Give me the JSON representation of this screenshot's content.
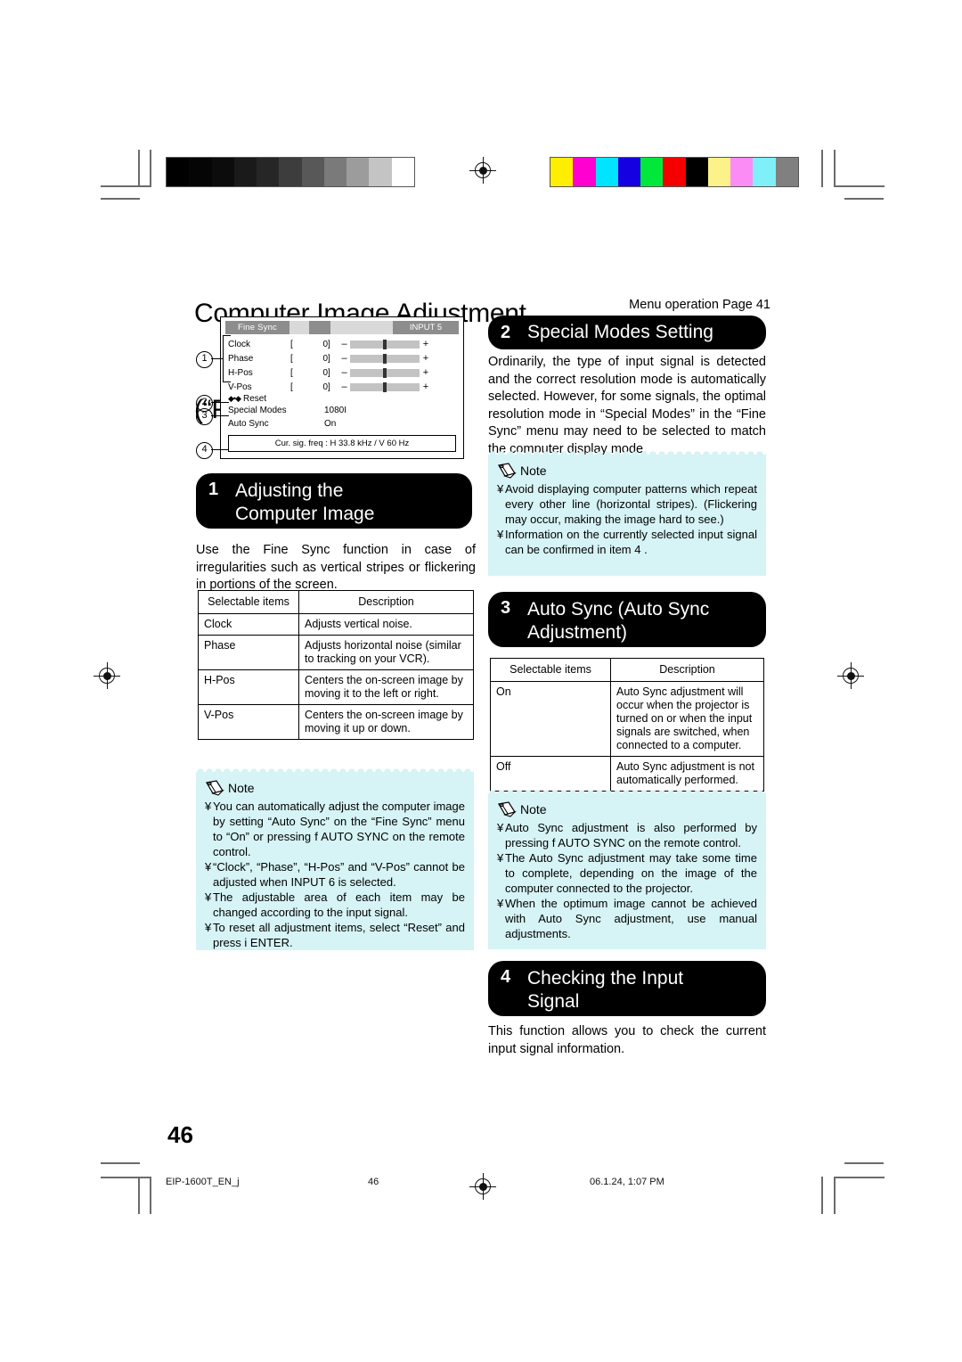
{
  "document": {
    "title_line1": "Computer Image Adjustment",
    "title_line2": "(“Fine Sync” menu)",
    "menu_operation_ref": "Menu operation      Page 41",
    "page_number": "46"
  },
  "footer": {
    "file_name": "EIP-1600T_EN_j",
    "page": "46",
    "timestamp": "06.1.24, 1:07 PM"
  },
  "osd": {
    "tab_label": "Fine Sync",
    "input_label": "INPUT 5",
    "rows": [
      {
        "label": "Clock",
        "bracket_left": "[",
        "value": "0",
        "bracket_right": "]",
        "minus": "–",
        "plus": "+"
      },
      {
        "label": "Phase",
        "bracket_left": "[",
        "value": "0",
        "bracket_right": "]",
        "minus": "–",
        "plus": "+"
      },
      {
        "label": "H-Pos",
        "bracket_left": "[",
        "value": "0",
        "bracket_right": "]",
        "minus": "–",
        "plus": "+"
      },
      {
        "label": "V-Pos",
        "bracket_left": "[",
        "value": "0",
        "bracket_right": "]",
        "minus": "–",
        "plus": "+"
      }
    ],
    "reset_label": "Reset",
    "reset_icons": "◆•◆",
    "special_modes": {
      "key": "Special Modes",
      "value": "1080I"
    },
    "auto_sync": {
      "key": "Auto Sync",
      "value": "On"
    },
    "status_bar": "Cur. sig. freq : H 33.8 kHz / V 60 Hz",
    "callouts": [
      "1",
      "2",
      "3",
      "4"
    ]
  },
  "sections": {
    "one": {
      "number": "1",
      "title": "Adjusting the\nComputer Image",
      "body": "Use the Fine Sync function in case of irregularities such as vertical stripes or flickering in portions of the screen."
    },
    "two": {
      "number": "2",
      "title": "Special Modes Setting",
      "body": "Ordinarily, the type of input signal is detected and the correct resolution mode is automatically selected. However, for some signals, the optimal resolution mode in “Special Modes” in the “Fine Sync” menu may need to be selected to match the computer display mode."
    },
    "three": {
      "number": "3",
      "title": "Auto Sync (Auto Sync\nAdjustment)"
    },
    "four": {
      "number": "4",
      "title": "Checking the Input\nSignal",
      "body": "This function allows you to check the current input signal information."
    }
  },
  "table_fine_sync": {
    "headers": [
      "Selectable items",
      "Description"
    ],
    "rows": [
      [
        "Clock",
        "Adjusts vertical noise."
      ],
      [
        "Phase",
        "Adjusts horizontal noise (similar to tracking on your VCR)."
      ],
      [
        "H-Pos",
        "Centers the on-screen image by moving it to the left or right."
      ],
      [
        "V-Pos",
        "Centers the on-screen image by moving it up or down."
      ]
    ]
  },
  "table_auto_sync": {
    "headers": [
      "Selectable items",
      "Description"
    ],
    "rows": [
      [
        "On",
        "Auto Sync adjustment will occur when the projector is turned on or when the input signals are switched, when connected to a computer."
      ],
      [
        "Off",
        "Auto Sync adjustment is not automatically performed."
      ]
    ]
  },
  "notes": {
    "label": "Note",
    "bullet": "¥",
    "left_fine_sync": [
      "You can automatically adjust the computer image by setting “Auto Sync” on the “Fine Sync” menu to “On” or pressing  f  AUTO SYNC on the remote control.",
      "“Clock”, “Phase”, “H-Pos” and “V-Pos” cannot be adjusted when INPUT 6 is selected.",
      "The adjustable area of each item may be changed according to the input signal.",
      "To reset all adjustment items, select “Reset” and press i  ENTER."
    ],
    "right_special_modes": [
      "Avoid displaying computer patterns which repeat every other line (horizontal stripes). (Flickering may occur, making the image hard to see.)",
      "Information on the currently selected input signal can be confirmed in item  4 ."
    ],
    "right_auto_sync": [
      "Auto Sync adjustment is also performed by pressing f   AUTO SYNC on the remote control.",
      "The Auto Sync adjustment may take some time to complete, depending on the image of the computer connected to the projector.",
      "When the optimum image cannot be achieved with Auto Sync adjustment, use manual adjustments."
    ]
  },
  "calibration": {
    "grayscale": [
      "#000000",
      "#050505",
      "#0c0c0c",
      "#1a1a1a",
      "#262626",
      "#3d3d3d",
      "#585858",
      "#7a7a7a",
      "#9c9c9c",
      "#c4c4c4",
      "#ffffff"
    ],
    "color": [
      "#ffee00",
      "#ff00d0",
      "#00e5ff",
      "#1400e0",
      "#00e83c",
      "#f40000",
      "#000000",
      "#fdf289",
      "#fb8cf5",
      "#7ff0f7",
      "#808080"
    ]
  }
}
